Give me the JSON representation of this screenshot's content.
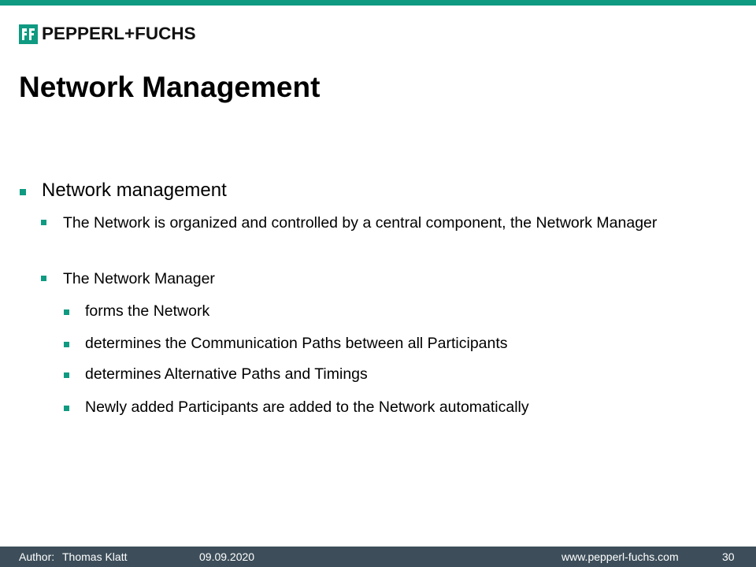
{
  "brand": {
    "name": "PEPPERL+FUCHS",
    "accent_color": "#0f9a82",
    "footer_color": "#3d4e5a"
  },
  "slide": {
    "title": "Network Management",
    "bullets": {
      "b1": "Network management",
      "b1_1": "The Network is organized and controlled by a central component, the Network Manager",
      "b1_2": "The Network Manager",
      "b1_2_1": "forms the Network",
      "b1_2_2": "determines the Communication Paths between all Participants",
      "b1_2_3": "determines Alternative Paths and Timings",
      "b1_2_4": "Newly added Participants are added to the Network automatically"
    }
  },
  "footer": {
    "author_label": "Author:",
    "author_name": "Thomas Klatt",
    "date": "09.09.2020",
    "website": "www.pepperl-fuchs.com",
    "page_number": "30"
  }
}
